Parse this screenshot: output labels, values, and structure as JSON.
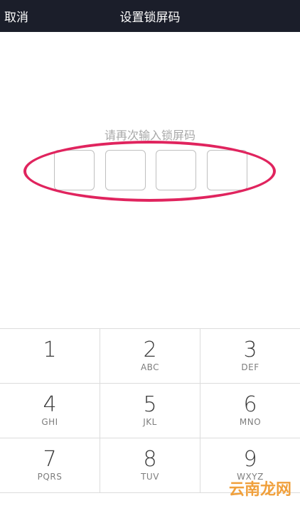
{
  "header": {
    "cancel_label": "取消",
    "title": "设置锁屏码"
  },
  "prompt": "请再次输入锁屏码",
  "pin": {
    "length": 4,
    "entered": 0
  },
  "keypad": {
    "rows": [
      [
        {
          "digit": "1",
          "letters": ""
        },
        {
          "digit": "2",
          "letters": "ABC"
        },
        {
          "digit": "3",
          "letters": "DEF"
        }
      ],
      [
        {
          "digit": "4",
          "letters": "GHI"
        },
        {
          "digit": "5",
          "letters": "JKL"
        },
        {
          "digit": "6",
          "letters": "MNO"
        }
      ],
      [
        {
          "digit": "7",
          "letters": "PQRS"
        },
        {
          "digit": "8",
          "letters": "TUV"
        },
        {
          "digit": "9",
          "letters": "WXYZ"
        }
      ]
    ]
  },
  "watermark": "云南龙网",
  "colors": {
    "header_bg": "#1b1e2a",
    "highlight": "#e0245e",
    "prompt_text": "#a8a8a8"
  }
}
